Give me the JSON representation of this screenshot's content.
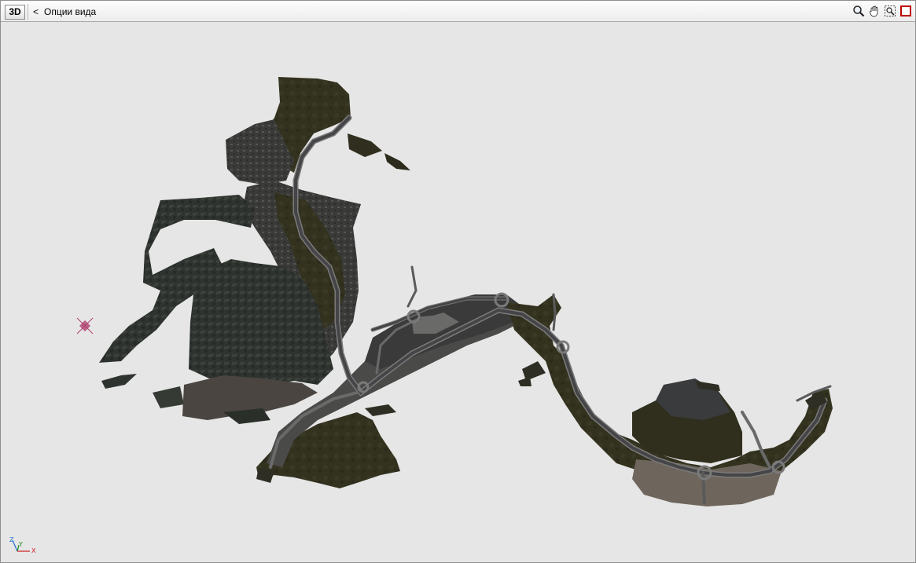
{
  "toolbar": {
    "mode_button_label": "3D",
    "back_glyph": "<",
    "view_options_label": "Опции вида",
    "tools": [
      {
        "name": "zoom-icon"
      },
      {
        "name": "pan-hand-icon"
      },
      {
        "name": "zoom-extents-icon"
      },
      {
        "name": "maximize-icon"
      }
    ]
  },
  "viewport": {
    "axis_labels": {
      "z": "Z",
      "y": "Y",
      "x": "X"
    },
    "colors": {
      "background": "#e6e6e6",
      "terrain_dark": "#2c2c22",
      "terrain_olive": "#3b3a28",
      "forest": "#303430",
      "road": "#4a4a4c",
      "road_edge": "#7a7a7a",
      "sand": "#6e665c",
      "marker": "#b04070"
    }
  }
}
